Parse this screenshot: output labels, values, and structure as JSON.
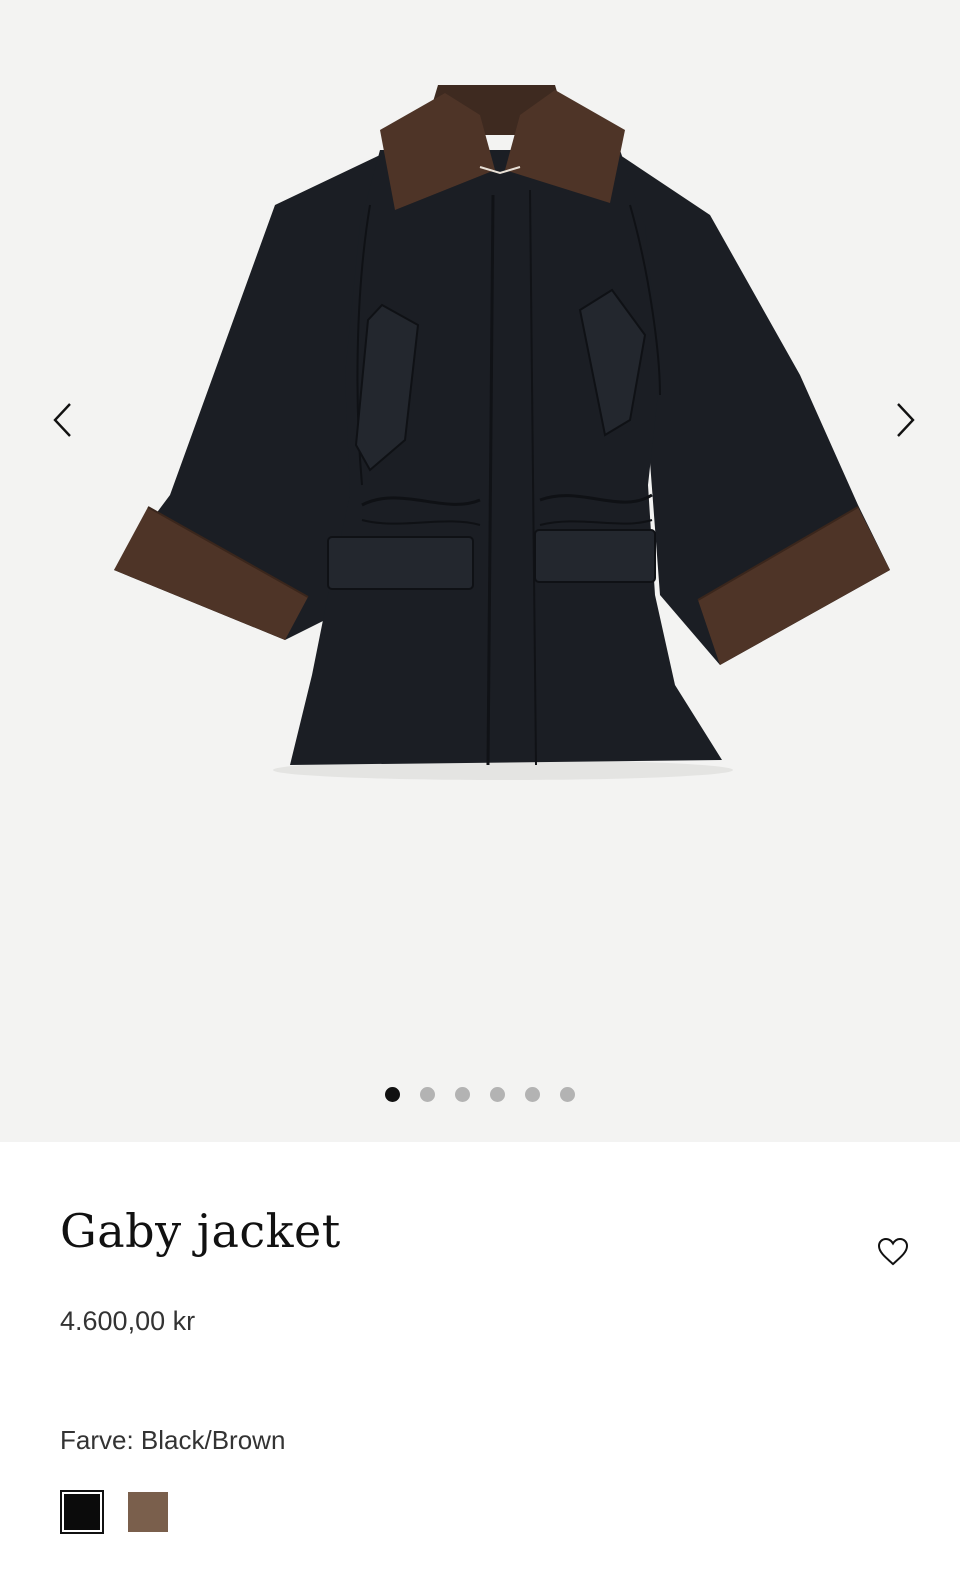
{
  "product": {
    "name": "Gaby jacket",
    "price": "4.600,00 kr",
    "color_label": "Farve: Black/Brown"
  },
  "gallery": {
    "image_count": 6,
    "active_index": 0,
    "prev_icon": "chevron-left-icon",
    "next_icon": "chevron-right-icon"
  },
  "swatches": [
    {
      "name": "black",
      "color": "#0b0b0b",
      "selected": true
    },
    {
      "name": "brown",
      "color": "#7a5f4c",
      "selected": false
    }
  ],
  "colors": {
    "gallery_bg": "#f3f3f2",
    "jacket_body": "#1b1e24",
    "jacket_trim": "#4e3427",
    "dot_active": "#111111",
    "dot_inactive": "#b3b3b3"
  }
}
